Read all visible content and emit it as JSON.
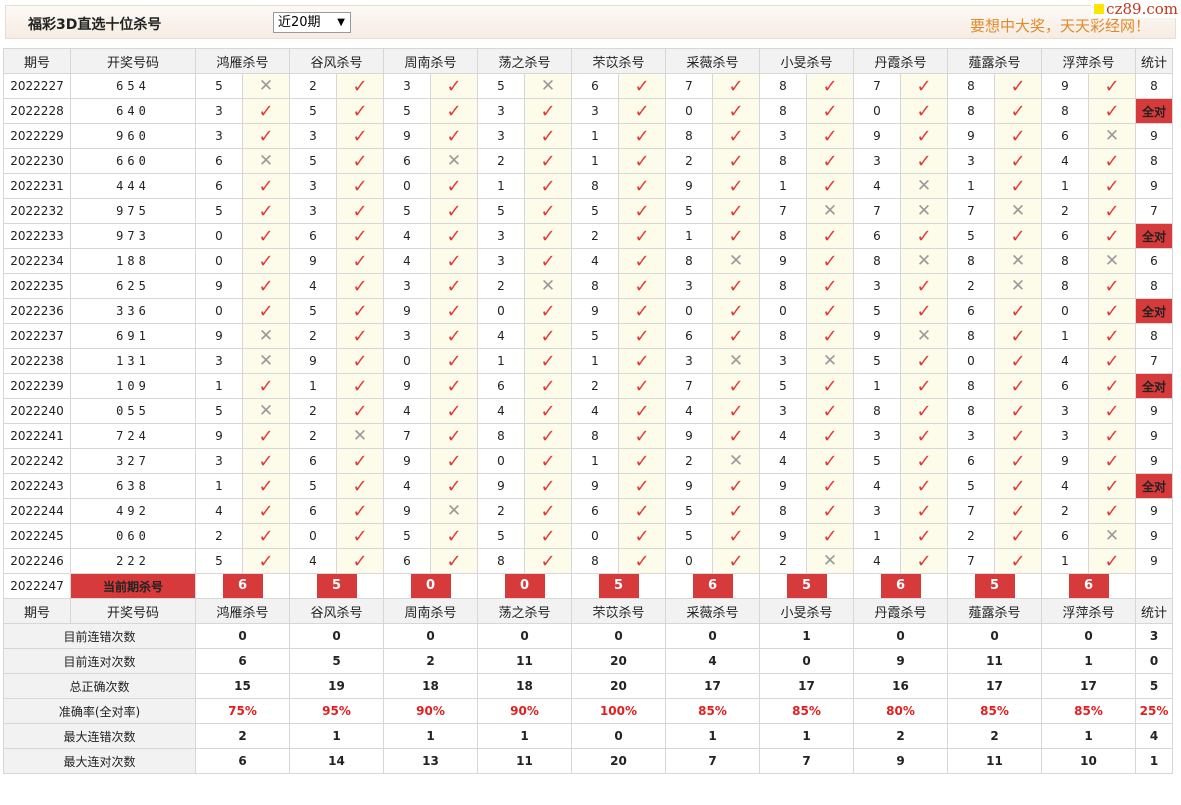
{
  "title": "福彩3D直选十位杀号",
  "period_select": "近20期",
  "slogan": "要想中大奖，天天彩经网！",
  "logo": "cz89.com",
  "headers": [
    "期号",
    "开奖号码",
    "鸿雁杀号",
    "谷风杀号",
    "周南杀号",
    "荡之杀号",
    "芣苡杀号",
    "采薇杀号",
    "小旻杀号",
    "丹霞杀号",
    "薤露杀号",
    "浮萍杀号",
    "统计"
  ],
  "rows": [
    {
      "period": "2022227",
      "nums": "654",
      "picks": [
        [
          "5",
          "x"
        ],
        [
          "2",
          "v"
        ],
        [
          "3",
          "v"
        ],
        [
          "5",
          "x"
        ],
        [
          "6",
          "v"
        ],
        [
          "7",
          "v"
        ],
        [
          "8",
          "v"
        ],
        [
          "7",
          "v"
        ],
        [
          "8",
          "v"
        ],
        [
          "9",
          "v"
        ]
      ],
      "stat": "8"
    },
    {
      "period": "2022228",
      "nums": "640",
      "picks": [
        [
          "3",
          "v"
        ],
        [
          "5",
          "v"
        ],
        [
          "5",
          "v"
        ],
        [
          "3",
          "v"
        ],
        [
          "3",
          "v"
        ],
        [
          "0",
          "v"
        ],
        [
          "8",
          "v"
        ],
        [
          "0",
          "v"
        ],
        [
          "8",
          "v"
        ],
        [
          "8",
          "v"
        ]
      ],
      "stat": "全对"
    },
    {
      "period": "2022229",
      "nums": "960",
      "picks": [
        [
          "3",
          "v"
        ],
        [
          "3",
          "v"
        ],
        [
          "9",
          "v"
        ],
        [
          "3",
          "v"
        ],
        [
          "1",
          "v"
        ],
        [
          "8",
          "v"
        ],
        [
          "3",
          "v"
        ],
        [
          "9",
          "v"
        ],
        [
          "9",
          "v"
        ],
        [
          "6",
          "x"
        ]
      ],
      "stat": "9"
    },
    {
      "period": "2022230",
      "nums": "660",
      "picks": [
        [
          "6",
          "x"
        ],
        [
          "5",
          "v"
        ],
        [
          "6",
          "x"
        ],
        [
          "2",
          "v"
        ],
        [
          "1",
          "v"
        ],
        [
          "2",
          "v"
        ],
        [
          "8",
          "v"
        ],
        [
          "3",
          "v"
        ],
        [
          "3",
          "v"
        ],
        [
          "4",
          "v"
        ]
      ],
      "stat": "8"
    },
    {
      "period": "2022231",
      "nums": "444",
      "picks": [
        [
          "6",
          "v"
        ],
        [
          "3",
          "v"
        ],
        [
          "0",
          "v"
        ],
        [
          "1",
          "v"
        ],
        [
          "8",
          "v"
        ],
        [
          "9",
          "v"
        ],
        [
          "1",
          "v"
        ],
        [
          "4",
          "x"
        ],
        [
          "1",
          "v"
        ],
        [
          "1",
          "v"
        ]
      ],
      "stat": "9"
    },
    {
      "period": "2022232",
      "nums": "975",
      "picks": [
        [
          "5",
          "v"
        ],
        [
          "3",
          "v"
        ],
        [
          "5",
          "v"
        ],
        [
          "5",
          "v"
        ],
        [
          "5",
          "v"
        ],
        [
          "5",
          "v"
        ],
        [
          "7",
          "x"
        ],
        [
          "7",
          "x"
        ],
        [
          "7",
          "x"
        ],
        [
          "2",
          "v"
        ]
      ],
      "stat": "7"
    },
    {
      "period": "2022233",
      "nums": "973",
      "picks": [
        [
          "0",
          "v"
        ],
        [
          "6",
          "v"
        ],
        [
          "4",
          "v"
        ],
        [
          "3",
          "v"
        ],
        [
          "2",
          "v"
        ],
        [
          "1",
          "v"
        ],
        [
          "8",
          "v"
        ],
        [
          "6",
          "v"
        ],
        [
          "5",
          "v"
        ],
        [
          "6",
          "v"
        ]
      ],
      "stat": "全对"
    },
    {
      "period": "2022234",
      "nums": "188",
      "picks": [
        [
          "0",
          "v"
        ],
        [
          "9",
          "v"
        ],
        [
          "4",
          "v"
        ],
        [
          "3",
          "v"
        ],
        [
          "4",
          "v"
        ],
        [
          "8",
          "x"
        ],
        [
          "9",
          "v"
        ],
        [
          "8",
          "x"
        ],
        [
          "8",
          "x"
        ],
        [
          "8",
          "x"
        ]
      ],
      "stat": "6"
    },
    {
      "period": "2022235",
      "nums": "625",
      "picks": [
        [
          "9",
          "v"
        ],
        [
          "4",
          "v"
        ],
        [
          "3",
          "v"
        ],
        [
          "2",
          "x"
        ],
        [
          "8",
          "v"
        ],
        [
          "3",
          "v"
        ],
        [
          "8",
          "v"
        ],
        [
          "3",
          "v"
        ],
        [
          "2",
          "x"
        ],
        [
          "8",
          "v"
        ]
      ],
      "stat": "8"
    },
    {
      "period": "2022236",
      "nums": "336",
      "picks": [
        [
          "0",
          "v"
        ],
        [
          "5",
          "v"
        ],
        [
          "9",
          "v"
        ],
        [
          "0",
          "v"
        ],
        [
          "9",
          "v"
        ],
        [
          "0",
          "v"
        ],
        [
          "0",
          "v"
        ],
        [
          "5",
          "v"
        ],
        [
          "6",
          "v"
        ],
        [
          "0",
          "v"
        ]
      ],
      "stat": "全对"
    },
    {
      "period": "2022237",
      "nums": "691",
      "picks": [
        [
          "9",
          "x"
        ],
        [
          "2",
          "v"
        ],
        [
          "3",
          "v"
        ],
        [
          "4",
          "v"
        ],
        [
          "5",
          "v"
        ],
        [
          "6",
          "v"
        ],
        [
          "8",
          "v"
        ],
        [
          "9",
          "x"
        ],
        [
          "8",
          "v"
        ],
        [
          "1",
          "v"
        ]
      ],
      "stat": "8"
    },
    {
      "period": "2022238",
      "nums": "131",
      "picks": [
        [
          "3",
          "x"
        ],
        [
          "9",
          "v"
        ],
        [
          "0",
          "v"
        ],
        [
          "1",
          "v"
        ],
        [
          "1",
          "v"
        ],
        [
          "3",
          "x"
        ],
        [
          "3",
          "x"
        ],
        [
          "5",
          "v"
        ],
        [
          "0",
          "v"
        ],
        [
          "4",
          "v"
        ]
      ],
      "stat": "7"
    },
    {
      "period": "2022239",
      "nums": "109",
      "picks": [
        [
          "1",
          "v"
        ],
        [
          "1",
          "v"
        ],
        [
          "9",
          "v"
        ],
        [
          "6",
          "v"
        ],
        [
          "2",
          "v"
        ],
        [
          "7",
          "v"
        ],
        [
          "5",
          "v"
        ],
        [
          "1",
          "v"
        ],
        [
          "8",
          "v"
        ],
        [
          "6",
          "v"
        ]
      ],
      "stat": "全对"
    },
    {
      "period": "2022240",
      "nums": "055",
      "picks": [
        [
          "5",
          "x"
        ],
        [
          "2",
          "v"
        ],
        [
          "4",
          "v"
        ],
        [
          "4",
          "v"
        ],
        [
          "4",
          "v"
        ],
        [
          "4",
          "v"
        ],
        [
          "3",
          "v"
        ],
        [
          "8",
          "v"
        ],
        [
          "8",
          "v"
        ],
        [
          "3",
          "v"
        ]
      ],
      "stat": "9"
    },
    {
      "period": "2022241",
      "nums": "724",
      "picks": [
        [
          "9",
          "v"
        ],
        [
          "2",
          "x"
        ],
        [
          "7",
          "v"
        ],
        [
          "8",
          "v"
        ],
        [
          "8",
          "v"
        ],
        [
          "9",
          "v"
        ],
        [
          "4",
          "v"
        ],
        [
          "3",
          "v"
        ],
        [
          "3",
          "v"
        ],
        [
          "3",
          "v"
        ]
      ],
      "stat": "9"
    },
    {
      "period": "2022242",
      "nums": "327",
      "picks": [
        [
          "3",
          "v"
        ],
        [
          "6",
          "v"
        ],
        [
          "9",
          "v"
        ],
        [
          "0",
          "v"
        ],
        [
          "1",
          "v"
        ],
        [
          "2",
          "x"
        ],
        [
          "4",
          "v"
        ],
        [
          "5",
          "v"
        ],
        [
          "6",
          "v"
        ],
        [
          "9",
          "v"
        ]
      ],
      "stat": "9"
    },
    {
      "period": "2022243",
      "nums": "638",
      "picks": [
        [
          "1",
          "v"
        ],
        [
          "5",
          "v"
        ],
        [
          "4",
          "v"
        ],
        [
          "9",
          "v"
        ],
        [
          "9",
          "v"
        ],
        [
          "9",
          "v"
        ],
        [
          "9",
          "v"
        ],
        [
          "4",
          "v"
        ],
        [
          "5",
          "v"
        ],
        [
          "4",
          "v"
        ]
      ],
      "stat": "全对"
    },
    {
      "period": "2022244",
      "nums": "492",
      "picks": [
        [
          "4",
          "v"
        ],
        [
          "6",
          "v"
        ],
        [
          "9",
          "x"
        ],
        [
          "2",
          "v"
        ],
        [
          "6",
          "v"
        ],
        [
          "5",
          "v"
        ],
        [
          "8",
          "v"
        ],
        [
          "3",
          "v"
        ],
        [
          "7",
          "v"
        ],
        [
          "2",
          "v"
        ]
      ],
      "stat": "9"
    },
    {
      "period": "2022245",
      "nums": "060",
      "picks": [
        [
          "2",
          "v"
        ],
        [
          "0",
          "v"
        ],
        [
          "5",
          "v"
        ],
        [
          "5",
          "v"
        ],
        [
          "0",
          "v"
        ],
        [
          "5",
          "v"
        ],
        [
          "9",
          "v"
        ],
        [
          "1",
          "v"
        ],
        [
          "2",
          "v"
        ],
        [
          "6",
          "x"
        ]
      ],
      "stat": "9"
    },
    {
      "period": "2022246",
      "nums": "222",
      "picks": [
        [
          "5",
          "v"
        ],
        [
          "4",
          "v"
        ],
        [
          "6",
          "v"
        ],
        [
          "8",
          "v"
        ],
        [
          "8",
          "v"
        ],
        [
          "0",
          "v"
        ],
        [
          "2",
          "x"
        ],
        [
          "4",
          "v"
        ],
        [
          "7",
          "v"
        ],
        [
          "1",
          "v"
        ]
      ],
      "stat": "9"
    }
  ],
  "current": {
    "period": "2022247",
    "label": "当前期杀号",
    "picks": [
      "6",
      "5",
      "0",
      "0",
      "5",
      "6",
      "5",
      "6",
      "5",
      "6"
    ]
  },
  "stats": [
    {
      "label": "目前连错次数",
      "values": [
        "0",
        "0",
        "0",
        "0",
        "0",
        "0",
        "1",
        "0",
        "0",
        "0",
        "3"
      ]
    },
    {
      "label": "目前连对次数",
      "values": [
        "6",
        "5",
        "2",
        "11",
        "20",
        "4",
        "0",
        "9",
        "11",
        "1",
        "0"
      ]
    },
    {
      "label": "总正确次数",
      "values": [
        "15",
        "19",
        "18",
        "18",
        "20",
        "17",
        "17",
        "16",
        "17",
        "17",
        "5"
      ]
    },
    {
      "label": "准确率(全对率)",
      "values": [
        "75%",
        "95%",
        "90%",
        "90%",
        "100%",
        "85%",
        "85%",
        "80%",
        "85%",
        "85%",
        "25%"
      ],
      "rate": true
    },
    {
      "label": "最大连错次数",
      "values": [
        "2",
        "1",
        "1",
        "1",
        "0",
        "1",
        "1",
        "2",
        "2",
        "1",
        "4"
      ]
    },
    {
      "label": "最大连对次数",
      "values": [
        "6",
        "14",
        "13",
        "11",
        "20",
        "7",
        "7",
        "9",
        "11",
        "10",
        "1"
      ]
    }
  ],
  "colors": {
    "red": "#d63a3a",
    "blue": "#1c3ec4",
    "check": "#e23a3a",
    "cross": "#9a9a9a",
    "orange": "#e08a2c"
  },
  "icons": {
    "check": "check-icon",
    "cross": "cross-icon"
  }
}
